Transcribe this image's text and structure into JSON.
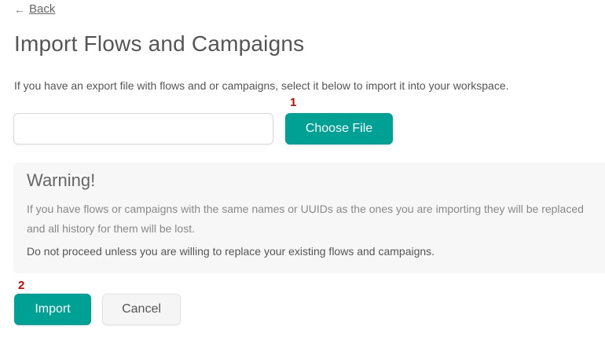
{
  "nav": {
    "back_arrow": "←",
    "back_label": "Back"
  },
  "title": "Import Flows and Campaigns",
  "intro": "If you have an export file with flows and or campaigns, select it below to import it into your workspace.",
  "markers": {
    "choose_file": "1",
    "import": "2"
  },
  "file_input": {
    "value": "",
    "placeholder": ""
  },
  "buttons": {
    "choose_file": "Choose File",
    "import": "Import",
    "cancel": "Cancel"
  },
  "warning": {
    "title": "Warning!",
    "text": "If you have flows or campaigns with the same names or UUIDs as the ones you are importing they will be replaced and all history for them will be lost.",
    "emphasis": "Do not proceed unless you are willing to replace your existing flows and campaigns."
  },
  "colors": {
    "primary": "#00a195",
    "marker": "#d20000",
    "warning_bg": "#f7f7f7"
  }
}
